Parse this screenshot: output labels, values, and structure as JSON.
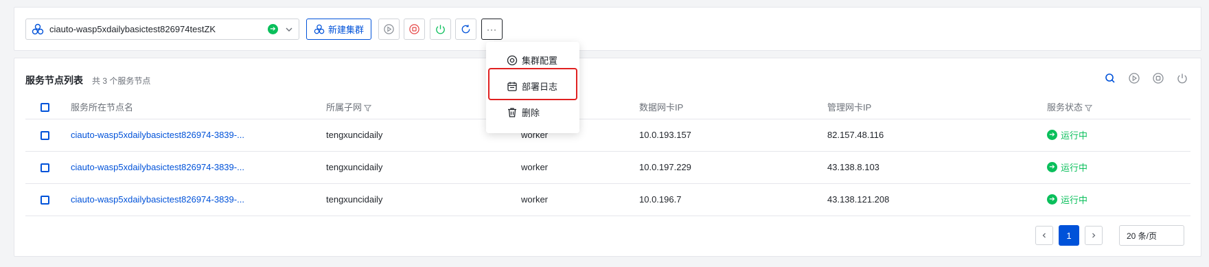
{
  "toolbar": {
    "cluster_name": "ciauto-wasp5xdailybasictest826974testZK",
    "new_cluster_label": "新建集群",
    "more_label": "···"
  },
  "menu": {
    "items": [
      {
        "label": "集群配置",
        "icon": "settings-circle-icon"
      },
      {
        "label": "部署日志",
        "icon": "calendar-log-icon"
      },
      {
        "label": "删除",
        "icon": "trash-icon"
      }
    ]
  },
  "panel": {
    "title": "服务节点列表",
    "subtitle": "共 3 个服务节点"
  },
  "table": {
    "headers": [
      "服务所在节点名",
      "所属子网",
      "",
      "数据网卡IP",
      "管理网卡IP",
      "服务状态"
    ],
    "rows": [
      {
        "name": "ciauto-wasp5xdailybasictest826974-3839-...",
        "subnet": "tengxuncidaily",
        "role": "worker",
        "data_ip": "10.0.193.157",
        "mgmt_ip": "82.157.48.116",
        "status": "运行中"
      },
      {
        "name": "ciauto-wasp5xdailybasictest826974-3839-...",
        "subnet": "tengxuncidaily",
        "role": "worker",
        "data_ip": "10.0.197.229",
        "mgmt_ip": "43.138.8.103",
        "status": "运行中"
      },
      {
        "name": "ciauto-wasp5xdailybasictest826974-3839-...",
        "subnet": "tengxuncidaily",
        "role": "worker",
        "data_ip": "10.0.196.7",
        "mgmt_ip": "43.138.121.208",
        "status": "运行中"
      }
    ]
  },
  "pagination": {
    "current_page": "1",
    "page_size": "20 条/页"
  },
  "colors": {
    "primary": "#0052d9",
    "success": "#0abf5b",
    "danger": "#e02020"
  }
}
